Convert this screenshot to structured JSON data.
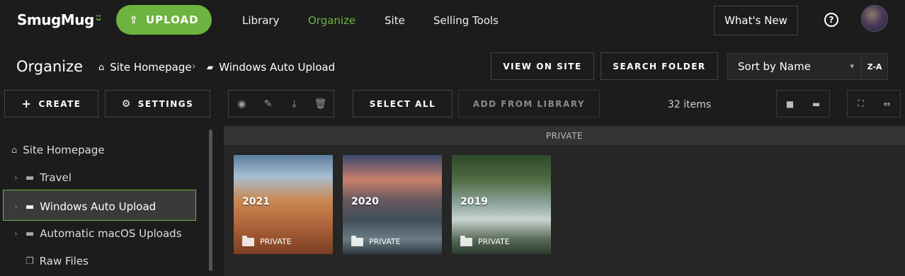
{
  "nav": {
    "logo": "SmugMug",
    "upload_label": "UPLOAD",
    "links": [
      "Library",
      "Organize",
      "Site",
      "Selling Tools"
    ],
    "active_link": "Organize",
    "whats_new": "What's New",
    "help_icon": "?"
  },
  "header": {
    "title": "Organize",
    "breadcrumb": [
      "Site Homepage",
      "Windows Auto Upload"
    ],
    "view_on_site": "VIEW ON SITE",
    "search_folder": "SEARCH FOLDER",
    "sort_value": "Sort by Name",
    "sort_order": "Z-A"
  },
  "toolbar": {
    "create": "CREATE",
    "settings": "SETTINGS",
    "select_all": "SELECT ALL",
    "add_from_library": "ADD FROM LIBRARY",
    "items_count": "32 items",
    "icons": [
      "eye-icon",
      "wrench-icon",
      "download-icon",
      "trash-icon"
    ]
  },
  "sidebar": {
    "items": [
      {
        "label": "Site Homepage",
        "icon": "home-icon"
      },
      {
        "label": "Travel",
        "icon": "folder-icon"
      },
      {
        "label": "Windows Auto Upload",
        "icon": "folder-icon",
        "selected": true
      },
      {
        "label": "Automatic macOS Uploads",
        "icon": "folder-icon"
      },
      {
        "label": "Raw Files",
        "icon": "gallery-icon"
      }
    ]
  },
  "main": {
    "section_label": "PRIVATE",
    "folders": [
      {
        "name": "2021",
        "privacy": "PRIVATE"
      },
      {
        "name": "2020",
        "privacy": "PRIVATE"
      },
      {
        "name": "2019",
        "privacy": "PRIVATE"
      }
    ]
  },
  "colors": {
    "accent": "#6db33f",
    "background": "#1c1c1c",
    "panel": "#262626"
  }
}
